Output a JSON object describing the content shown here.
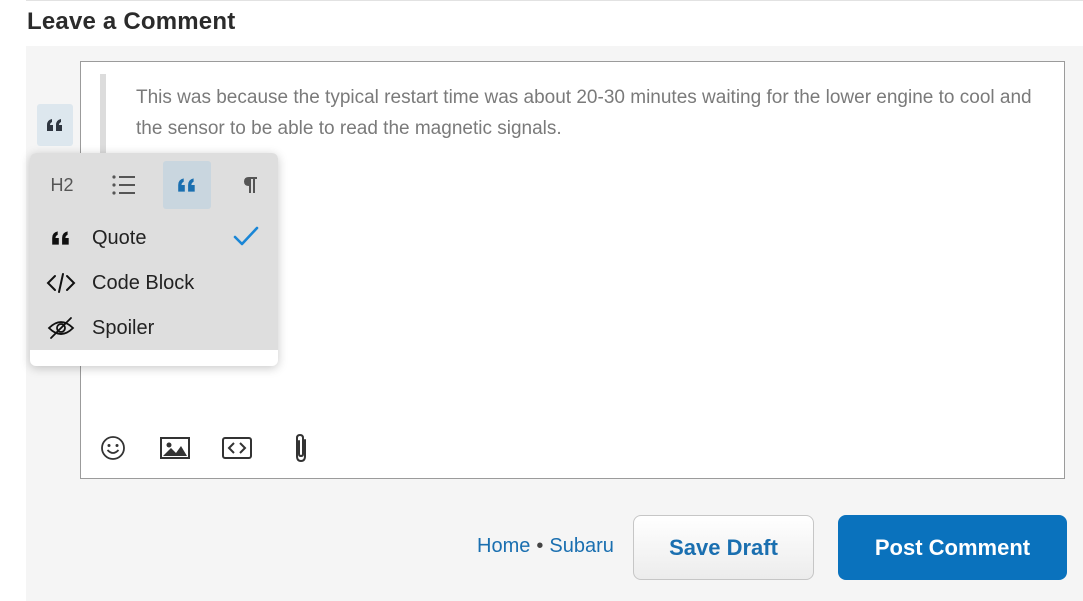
{
  "section": {
    "heading": "Leave a Comment"
  },
  "editor": {
    "quote_text": "This was because the typical restart time was about 20-30 minutes waiting for the lower engine to cool and the sensor to be able to read the magnetic signals.",
    "side_button_icon": "quote-icon",
    "toolbar": [
      {
        "icon": "emoji-icon"
      },
      {
        "icon": "image-icon"
      },
      {
        "icon": "code-inline-icon"
      },
      {
        "icon": "attachment-icon"
      }
    ]
  },
  "block_menu": {
    "format_row": [
      {
        "label": "H2",
        "icon": "heading-icon"
      },
      {
        "icon": "list-icon"
      },
      {
        "icon": "quote-icon",
        "active": true
      },
      {
        "icon": "paragraph-icon"
      }
    ],
    "items": [
      {
        "label": "Quote",
        "icon": "quote-icon",
        "selected": true
      },
      {
        "label": "Code Block",
        "icon": "code-icon",
        "selected": false
      },
      {
        "label": "Spoiler",
        "icon": "eye-off-icon",
        "selected": false
      }
    ],
    "accent_color": "#1a86d6"
  },
  "footer": {
    "breadcrumb": [
      "Home",
      "Subaru"
    ],
    "separator": "•",
    "save_draft_label": "Save Draft",
    "post_comment_label": "Post Comment"
  },
  "colors": {
    "primary_button": "#0a72bd",
    "link": "#1a6fb0",
    "panel_bg": "#f5f5f5"
  }
}
